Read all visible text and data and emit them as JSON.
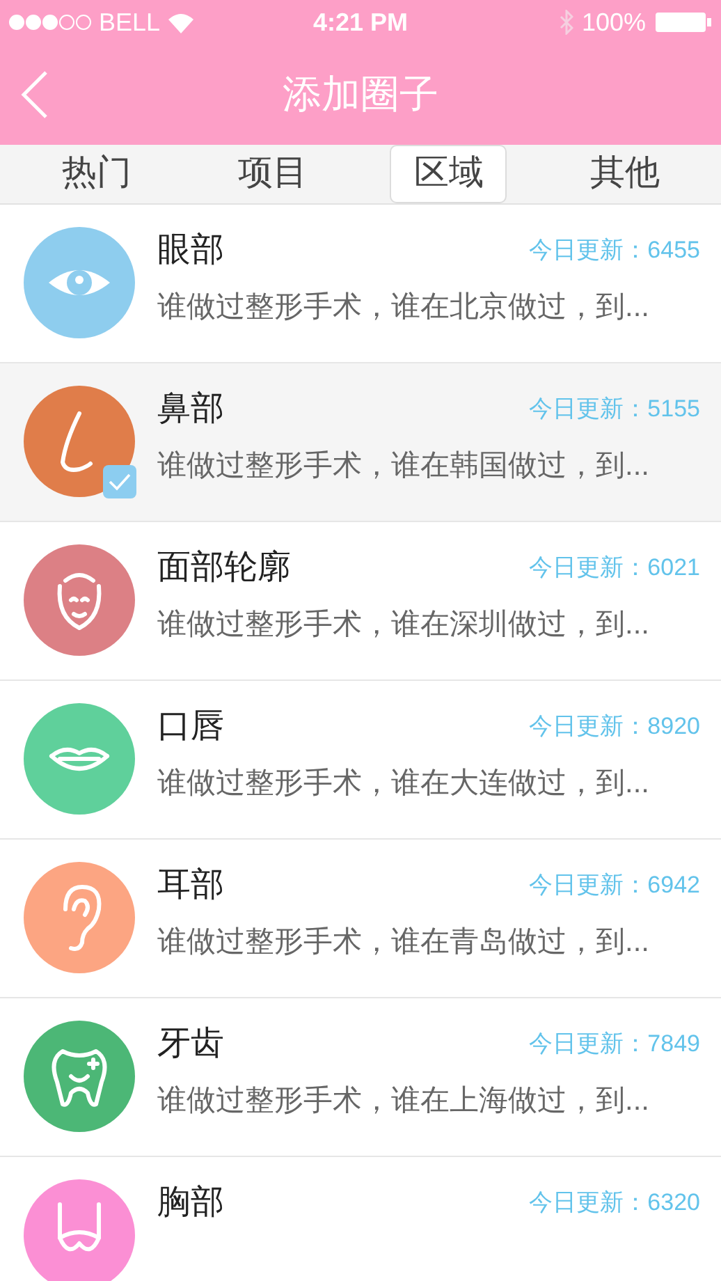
{
  "status_bar": {
    "carrier": "BELL",
    "time": "4:21 PM",
    "battery": "100%"
  },
  "nav": {
    "title": "添加圈子"
  },
  "tabs": [
    {
      "label": "热门",
      "selected": false
    },
    {
      "label": "项目",
      "selected": false
    },
    {
      "label": "区域",
      "selected": true
    },
    {
      "label": "其他",
      "selected": false
    }
  ],
  "circles": [
    {
      "name": "眼部",
      "update": "今日更新：6455",
      "description": "谁做过整形手术，谁在北京做过，到...",
      "kind": "eye",
      "color": "#8ecdee",
      "selected": false
    },
    {
      "name": "鼻部",
      "update": "今日更新：5155",
      "description": "谁做过整形手术，谁在韩国做过，到...",
      "kind": "nose",
      "color": "#e07d4a",
      "selected": true
    },
    {
      "name": "面部轮廓",
      "update": "今日更新：6021",
      "description": "谁做过整形手术，谁在深圳做过，到...",
      "kind": "face",
      "color": "#dc8085",
      "selected": false
    },
    {
      "name": "口唇",
      "update": "今日更新：8920",
      "description": "谁做过整形手术，谁在大连做过，到...",
      "kind": "lips",
      "color": "#5fd09b",
      "selected": false
    },
    {
      "name": "耳部",
      "update": "今日更新：6942",
      "description": "谁做过整形手术，谁在青岛做过，到...",
      "kind": "ear",
      "color": "#fca582",
      "selected": false
    },
    {
      "name": "牙齿",
      "update": "今日更新：7849",
      "description": "谁做过整形手术，谁在上海做过，到...",
      "kind": "tooth",
      "color": "#4cb776",
      "selected": false
    },
    {
      "name": "胸部",
      "update": "今日更新：6320",
      "kind": "bra",
      "color": "#fb8fd4",
      "selected": false
    }
  ]
}
